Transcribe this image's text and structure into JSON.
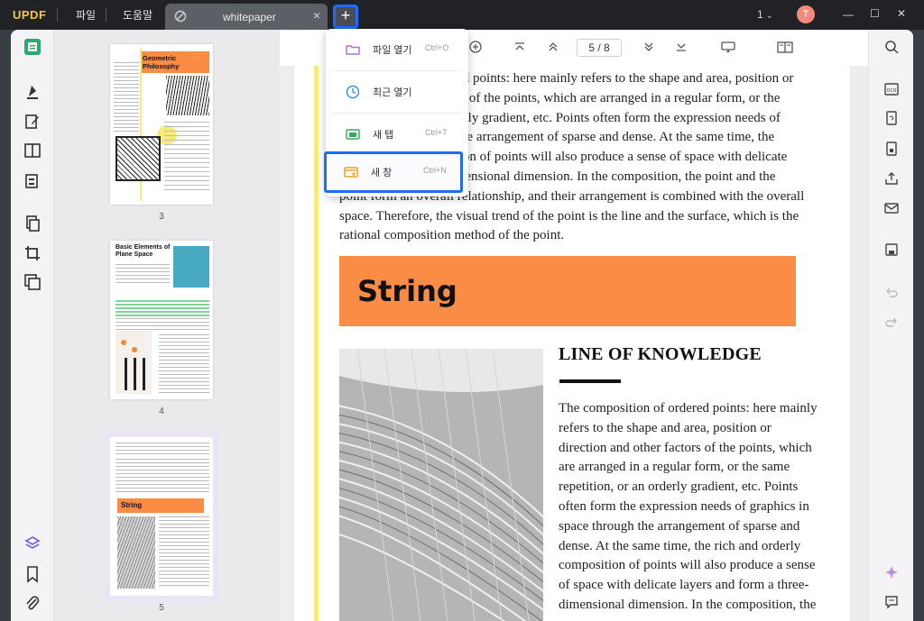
{
  "app": {
    "logo_u": "UPDF",
    "logo_pdf": ""
  },
  "menu": {
    "file": "파일",
    "help": "도움말"
  },
  "tab": {
    "title": "whitepaper",
    "close": "×"
  },
  "new_tab_button": "+",
  "window": {
    "tab_count": "1",
    "avatar_initial": "T",
    "minimize": "—",
    "maximize": "☐",
    "close": "✕"
  },
  "toolbar": {
    "page_indicator": "5 / 8"
  },
  "dropdown": {
    "items": [
      {
        "label": "파일 열기",
        "shortcut": "Ctrl+O",
        "icon": "folder-icon",
        "color": "#a56fe8"
      },
      {
        "label": "최근 열기",
        "shortcut": "",
        "icon": "clock-icon",
        "color": "#3a8fd8"
      },
      {
        "label": "새 탭",
        "shortcut": "Ctrl+T",
        "icon": "new-tab-icon",
        "color": "#3aa864"
      },
      {
        "label": "새 창",
        "shortcut": "Ctrl+N",
        "icon": "new-window-icon",
        "color": "#e6a22a"
      }
    ]
  },
  "thumbnails": [
    {
      "page": "3",
      "title": "Geometric Philosophy"
    },
    {
      "page": "4",
      "title": "Basic Elements of Plane Space"
    },
    {
      "page": "5",
      "title": "String"
    }
  ],
  "document": {
    "para_lines": [
      "dered points: here mainly refers to the shape and area, position or",
      "ctors of the points, which are arranged in a regular form, or the",
      "orderly gradient, etc. Points often form the expression needs of",
      "gh the arrangement of sparse and dense. At the same time, the",
      "osition of points will also produce a sense of space with delicate",
      "-dimensional dimension. In the composition, the point and the",
      "point form an overall relationship, and their arrangement is combined with the overall",
      "space. Therefore, the visual trend of the point is the line and the surface, which is the",
      "rational composition method of the point."
    ],
    "banner": "String",
    "heading": "LINE OF KNOWLEDGE",
    "body_lines": [
      "The composition of ordered points: here mainly",
      "refers to the shape and area, position or",
      "direction and other factors of the points, which",
      "are arranged in a regular form, or the same",
      "repetition, or an orderly gradient, etc. Points",
      "often form the expression needs of graphics in",
      "space through the arrangement of sparse and",
      "dense. At the same time, the rich and orderly",
      "composition of points will also produce a sense",
      "of space with delicate layers and form a three-",
      "dimensional dimension. In the composition, the"
    ]
  },
  "colors": {
    "accent_blue": "#1e6bff",
    "banner_orange": "#fb8c46",
    "titlebar": "#212226",
    "margin_yellow": "#f8eb7c"
  }
}
